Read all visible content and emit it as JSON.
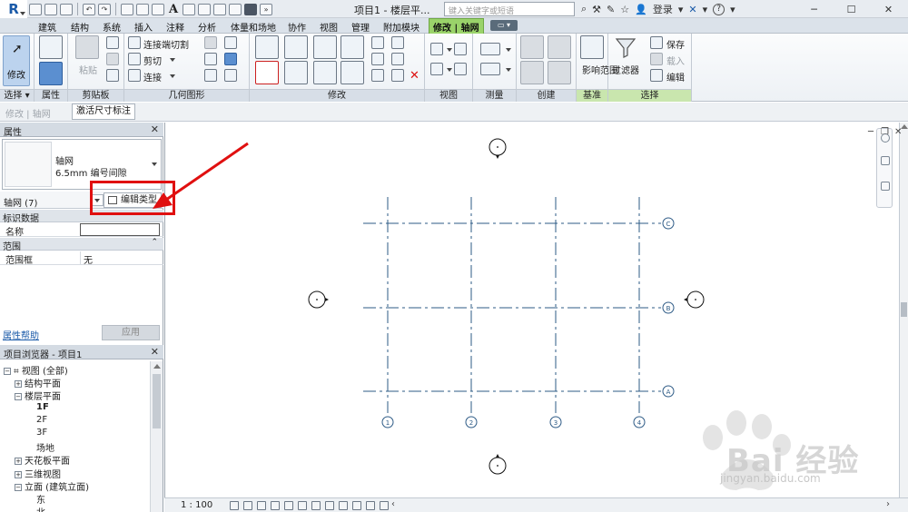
{
  "title_bar": {
    "title": "项目1 - 楼层平...",
    "search_placeholder": "键入关键字或短语",
    "login": "登录",
    "help": "?",
    "window_controls": [
      "─",
      "☐",
      "✕"
    ]
  },
  "ribbon_tabs": [
    {
      "label": "建筑"
    },
    {
      "label": "结构"
    },
    {
      "label": "系统"
    },
    {
      "label": "插入"
    },
    {
      "label": "注释"
    },
    {
      "label": "分析"
    },
    {
      "label": "体量和场地"
    },
    {
      "label": "协作"
    },
    {
      "label": "视图"
    },
    {
      "label": "管理"
    },
    {
      "label": "附加模块"
    },
    {
      "label": "修改 | 轴网",
      "active": true
    }
  ],
  "ribbon_panels": {
    "select": {
      "label": "选择",
      "modify_label": "修改"
    },
    "properties": {
      "label": "属性"
    },
    "clipboard": {
      "label": "剪贴板",
      "paste_label": "粘贴"
    },
    "geometry": {
      "label": "几何图形",
      "join_cut_label": "连接端切割",
      "cut_label": "剪切",
      "join_label": "连接"
    },
    "modify": {
      "label": "修改"
    },
    "view": {
      "label": "视图"
    },
    "measure": {
      "label": "测量"
    },
    "create": {
      "label": "创建"
    },
    "datum": {
      "label": "基准",
      "scope_label": "影响范围"
    },
    "select2": {
      "label": "选择",
      "filter_label": "过滤器",
      "save_label": "保存",
      "load_label": "载入",
      "edit_label": "编辑"
    }
  },
  "options_bar": {
    "context_label": "修改 | 轴网",
    "activate_dimensions": "激活尺寸标注"
  },
  "properties_panel": {
    "title": "属性",
    "type_name": "轴网",
    "type_subname": "6.5mm 编号间隙",
    "instance_label": "轴网 (7)",
    "edit_type_label": "编辑类型",
    "sections": [
      {
        "label": "标识数据",
        "rows": [
          {
            "key": "名称",
            "value": ""
          }
        ]
      },
      {
        "label": "范围",
        "rows": [
          {
            "key": "范围框",
            "value": "无"
          }
        ]
      }
    ],
    "help_link": "属性帮助",
    "apply_label": "应用"
  },
  "project_browser": {
    "title": "项目浏览器 - 项目1",
    "nodes": [
      {
        "label": "视图 (全部)",
        "level": 0,
        "expander": "−"
      },
      {
        "label": "结构平面",
        "level": 1,
        "expander": "+"
      },
      {
        "label": "楼层平面",
        "level": 1,
        "expander": "−"
      },
      {
        "label": "1F",
        "level": 2,
        "bold": true
      },
      {
        "label": "2F",
        "level": 2
      },
      {
        "label": "3F",
        "level": 2
      },
      {
        "label": "场地",
        "level": 2
      },
      {
        "label": "天花板平面",
        "level": 1,
        "expander": "+"
      },
      {
        "label": "三维视图",
        "level": 1,
        "expander": "+"
      },
      {
        "label": "立面 (建筑立面)",
        "level": 1,
        "expander": "−"
      },
      {
        "label": "东",
        "level": 2
      },
      {
        "label": "北",
        "level": 2
      }
    ]
  },
  "drawing": {
    "grid_color": "#2e5b86",
    "vertical_grids": [
      "1",
      "2",
      "3",
      "4"
    ],
    "horizontal_grids": [
      "C",
      "B",
      "A"
    ]
  },
  "status_bar": {
    "scale": "1 : 100"
  },
  "watermark": {
    "brand": "Bai 经验",
    "url": "jingyan.baidu.com"
  },
  "colors": {
    "highlight": "#e01010",
    "context_tab": "#9ad36a",
    "accent": "#1a5aa8"
  }
}
